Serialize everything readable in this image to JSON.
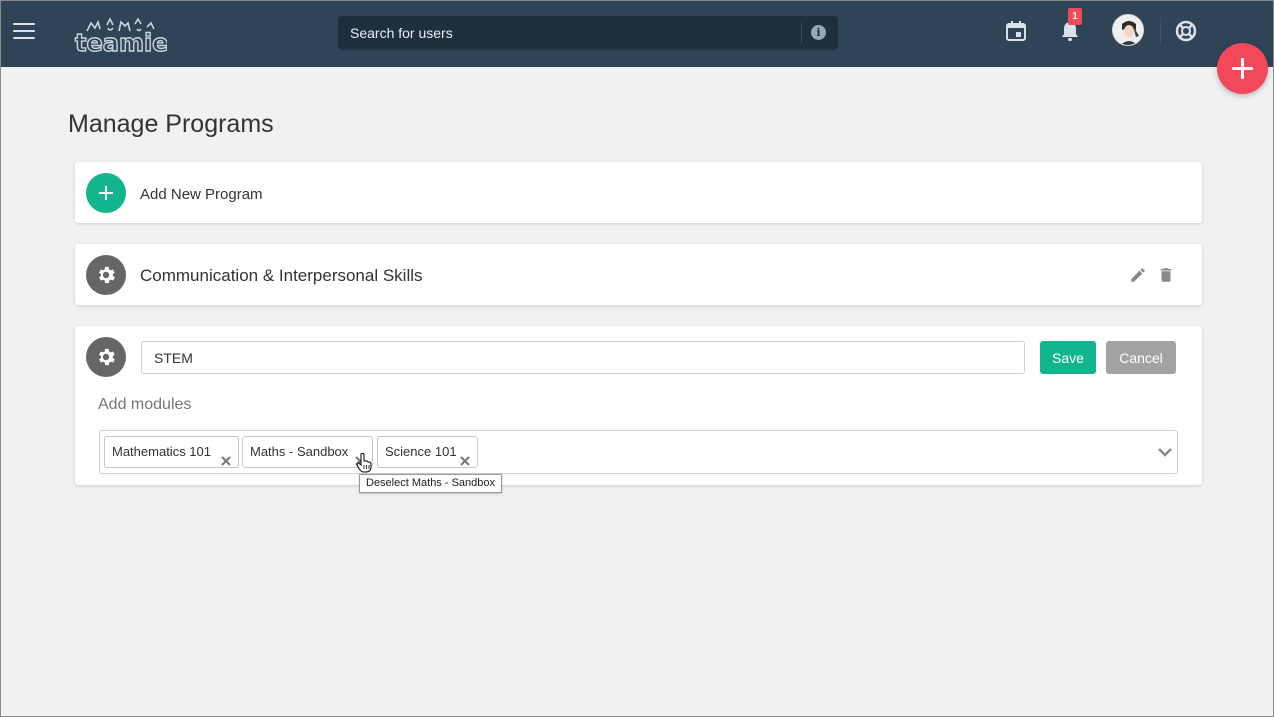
{
  "header": {
    "logo_text": "teamie",
    "search": {
      "placeholder": "Search for users"
    },
    "notifications": {
      "count": "1"
    },
    "icons": {
      "menu": "hamburger-menu-icon",
      "info": "info-icon",
      "calendar": "calendar-icon",
      "notifications": "bell-icon",
      "help": "lifebuoy-icon",
      "fab": "plus-icon"
    }
  },
  "main": {
    "title": "Manage Programs",
    "add_program": {
      "label": "Add New Program"
    },
    "programs": [
      {
        "name": "Communication & Interpersonal Skills"
      }
    ],
    "editor": {
      "name_value": "STEM",
      "save_label": "Save",
      "cancel_label": "Cancel",
      "modules_label": "Add modules",
      "modules": [
        {
          "label": "Mathematics 101"
        },
        {
          "label": "Maths - Sandbox"
        },
        {
          "label": "Science 101"
        }
      ]
    },
    "tooltip": "Deselect Maths - Sandbox"
  },
  "colors": {
    "topbar": "#2f4456",
    "accent_green": "#12b58e",
    "fab_red": "#f3475a",
    "badge_red": "#ef4a5a",
    "background": "#f1f1f3"
  }
}
